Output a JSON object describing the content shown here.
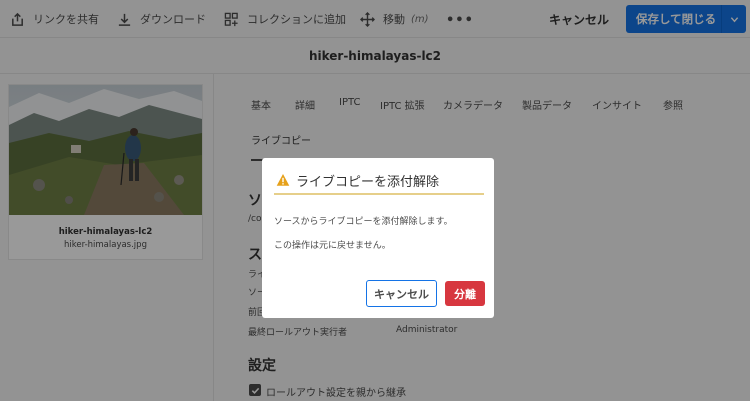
{
  "toolbar": {
    "share_link": "リンクを共有",
    "download": "ダウンロード",
    "add_to_collection": "コレクションに追加",
    "move": "移動",
    "move_hint": "(m)",
    "more": "•••",
    "cancel": "キャンセル",
    "save_close": "保存して閉じる"
  },
  "title": "hiker-himalayas-lc2",
  "asset_card": {
    "name": "hiker-himalayas-lc2",
    "filename": "hiker-himalayas.jpg"
  },
  "tabs": [
    "基本",
    "詳細",
    "IPTC",
    "IPTC 拡張",
    "カメラデータ",
    "製品データ",
    "インサイト",
    "参照"
  ],
  "active_tab": "ライブコピー",
  "background": {
    "source_head_partial": "ソ",
    "source_path_partial": "/con",
    "status_head_partial": "ス",
    "row1_partial": "ライ",
    "row2_partial": "ソー",
    "row3_partial": "前回",
    "last_rollout_by_label": "最終ロールアウト実行者",
    "last_rollout_by_value": "Administrator",
    "settings_head": "設定",
    "inherit_checkbox_label": "ロールアウト設定を親から継承"
  },
  "dialog": {
    "title": "ライブコピーを添付解除",
    "body1": "ソースからライブコピーを添付解除します。",
    "body2": "この操作は元に戻せません。",
    "cancel": "キャンセル",
    "detach": "分離"
  },
  "colors": {
    "accent": "#1473e6",
    "danger": "#d7373f",
    "warning": "#e6a11a"
  }
}
